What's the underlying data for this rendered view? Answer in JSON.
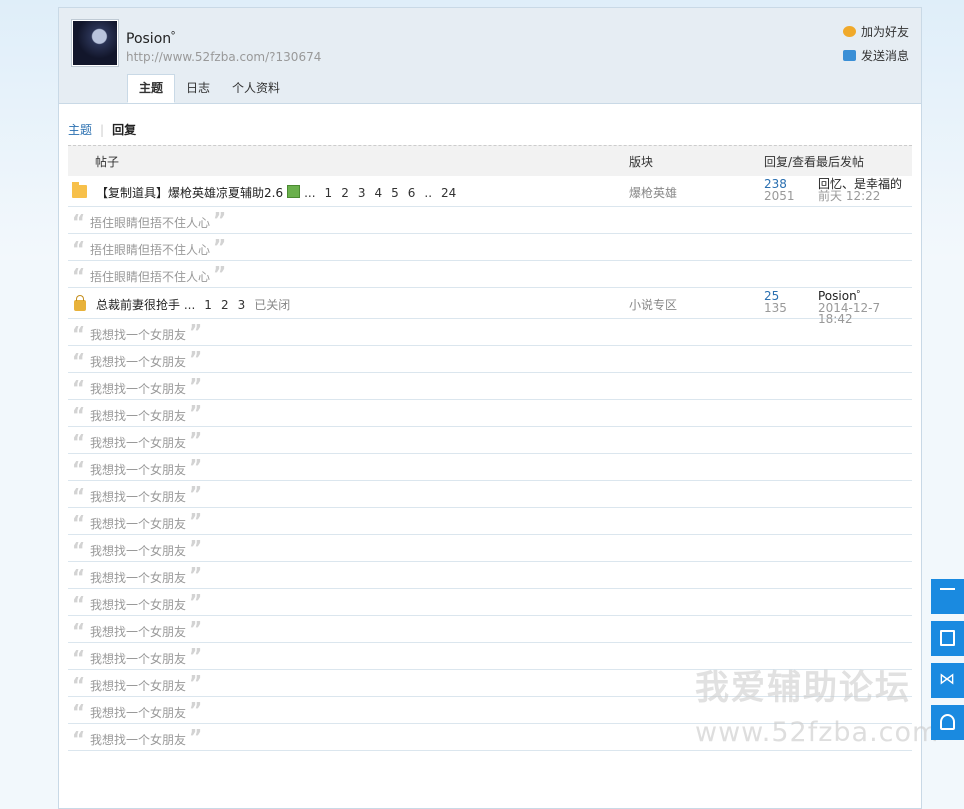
{
  "profile": {
    "username": "Posion゜",
    "url": "http://www.52fzba.com/?130674",
    "actions": [
      {
        "label": "加为好友",
        "icon": "add-friend-icon"
      },
      {
        "label": "发送消息",
        "icon": "message-icon"
      }
    ],
    "tabs": [
      {
        "label": "主题",
        "active": true
      },
      {
        "label": "日志",
        "active": false
      },
      {
        "label": "个人资料",
        "active": false
      }
    ]
  },
  "subnav": {
    "topics": "主题",
    "replies": "回复"
  },
  "table": {
    "headers": {
      "post": "帖子",
      "forum": "版块",
      "stats": "回复/查看",
      "last": "最后发帖"
    },
    "threads": [
      {
        "icon": "folder-icon",
        "title": "【复制道具】爆枪英雄凉夏辅助2.6",
        "has_image": true,
        "pages": [
          "...",
          "1",
          "2",
          "3",
          "4",
          "5",
          "6",
          "..",
          "24"
        ],
        "closed": "",
        "forum": "爆枪英雄",
        "replies": "238",
        "views": "2051",
        "last_user": "回忆、是幸福的",
        "last_time": "前天 12:22",
        "quotes": [
          "捂住眼睛但捂不住人心",
          "捂住眼睛但捂不住人心",
          "捂住眼睛但捂不住人心"
        ]
      },
      {
        "icon": "lock-icon",
        "title": "总裁前妻很抢手",
        "has_image": false,
        "pages": [
          "...",
          "1",
          "2",
          "3"
        ],
        "closed": "已关闭",
        "forum": "小说专区",
        "replies": "25",
        "views": "135",
        "last_user": "Posion゜",
        "last_time": "2014-12-7 18:42",
        "quotes": [
          "我想找一个女朋友",
          "我想找一个女朋友",
          "我想找一个女朋友",
          "我想找一个女朋友",
          "我想找一个女朋友",
          "我想找一个女朋友",
          "我想找一个女朋友",
          "我想找一个女朋友",
          "我想找一个女朋友",
          "我想找一个女朋友",
          "我想找一个女朋友",
          "我想找一个女朋友",
          "我想找一个女朋友",
          "我想找一个女朋友",
          "我想找一个女朋友",
          "我想找一个女朋友"
        ]
      }
    ]
  },
  "watermark": {
    "line1": "我爱辅助论坛",
    "line2": "www.52fzba.com"
  },
  "side_buttons": [
    "back-to-top-icon",
    "document-icon",
    "share-icon",
    "user-icon"
  ]
}
